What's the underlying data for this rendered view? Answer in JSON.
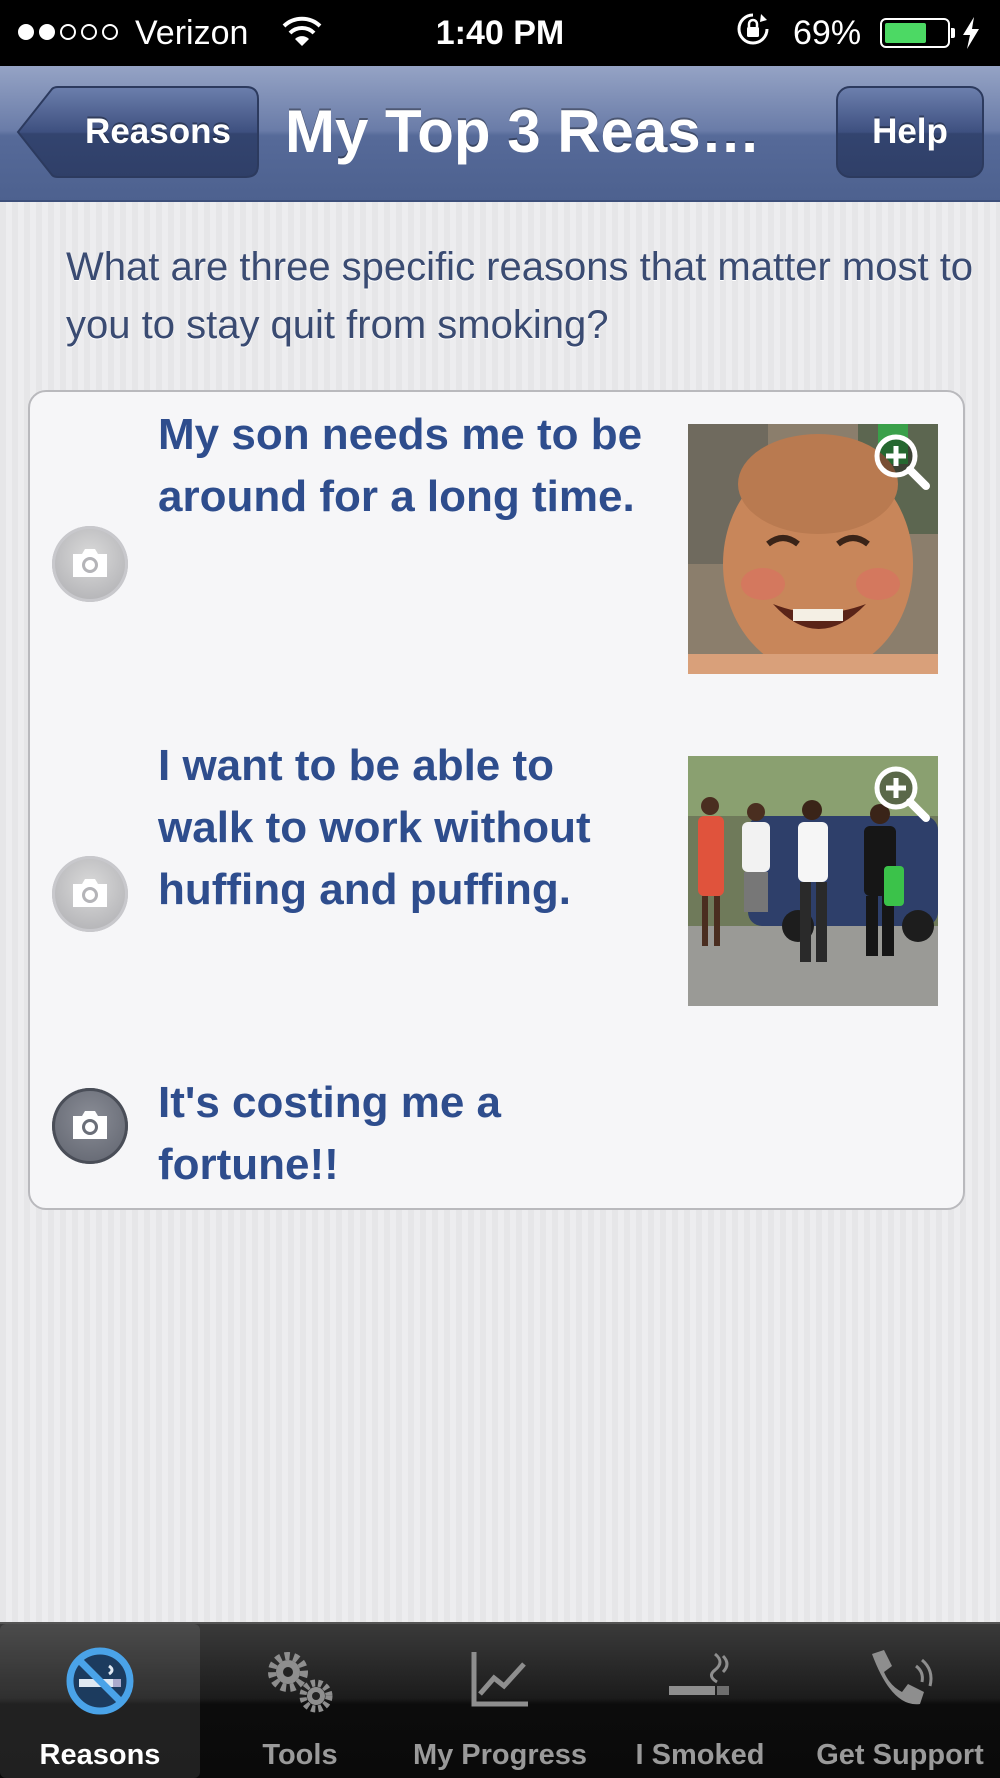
{
  "status_bar": {
    "carrier": "Verizon",
    "time": "1:40 PM",
    "battery": "69%",
    "battery_level": 0.69
  },
  "nav": {
    "back_label": "Reasons",
    "title": "My Top 3 Reas…",
    "help_label": "Help"
  },
  "prompt": "What are three specific reasons that matter most to you to stay quit from smoking?",
  "reasons": [
    {
      "text": "My son needs me to be around for a long time.",
      "camera_icon": "camera-icon",
      "has_photo": true
    },
    {
      "text": "I want to be able to walk to work without huffing and puffing.",
      "camera_icon": "camera-icon",
      "has_photo": true
    },
    {
      "text": "It's costing me a fortune!!",
      "camera_icon": "camera-icon",
      "has_photo": false
    }
  ],
  "tabs": [
    {
      "label": "Reasons",
      "icon": "no-smoking-icon",
      "selected": true
    },
    {
      "label": "Tools",
      "icon": "gears-icon",
      "selected": false
    },
    {
      "label": "My Progress",
      "icon": "line-chart-icon",
      "selected": false
    },
    {
      "label": "I Smoked",
      "icon": "cigarette-icon",
      "selected": false
    },
    {
      "label": "Get Support",
      "icon": "phone-icon",
      "selected": false
    }
  ],
  "colors": {
    "nav_bar": "#6a7ca8",
    "reason_text": "#2e4d8d",
    "prompt_text": "#3a4b72",
    "battery_fill": "#4cd964",
    "selected_tab_icon": "#4aa3e8"
  }
}
